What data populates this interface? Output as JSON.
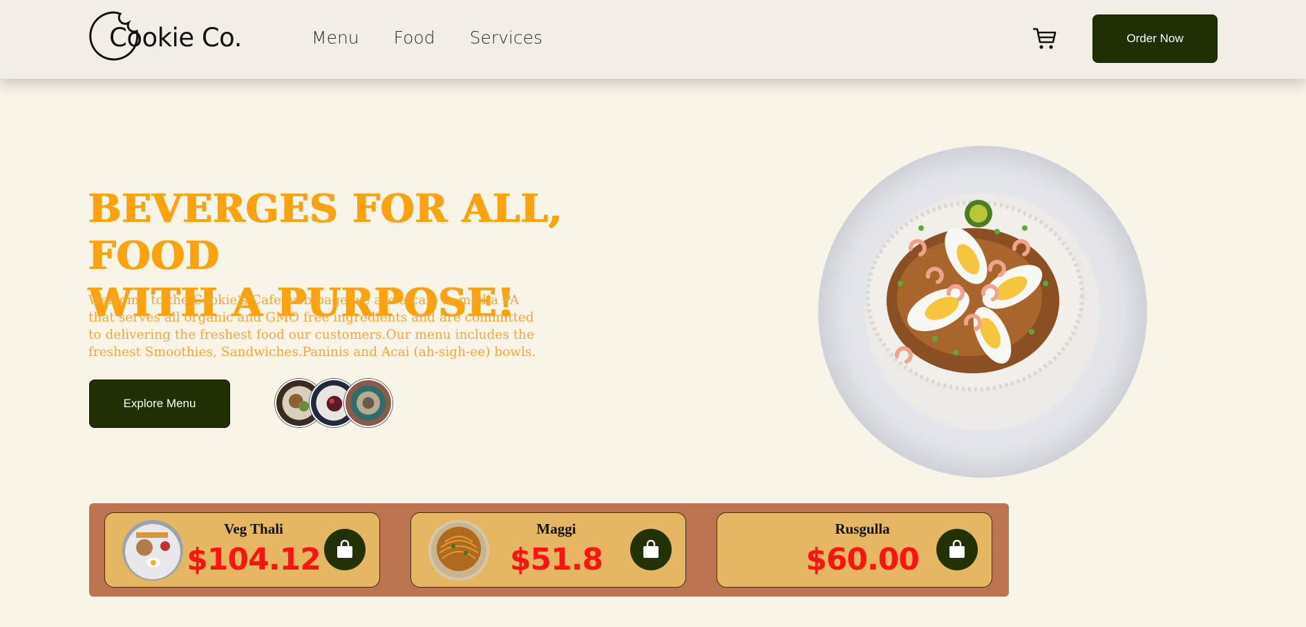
{
  "header": {
    "logo_text": "Cookie Co.",
    "nav": [
      "Menu",
      "Food",
      "Services"
    ],
    "order_button": "Order Now"
  },
  "hero": {
    "headline_line1": "BEVERGES FOR ALL, FOOD",
    "headline_line2": "WITH A PURPOSE!",
    "intro": "Welcome to the Cookie's Cafe web page.we are a cafe in media PA that serves all organic and GMO free ingredients and are committed to delivering the freshest food our customers.Our menu includes the freshest Smoothies, Sandwiches.Paninis and Acai (ah-sigh-ee) bowls.",
    "explore_button": "Explore Menu"
  },
  "products": [
    {
      "name": "Veg Thali",
      "price": "$104.12"
    },
    {
      "name": "Maggi",
      "price": "$51.8"
    },
    {
      "name": "Rusgulla",
      "price": "$60.00"
    }
  ],
  "colors": {
    "background": "#f8f4e8",
    "header": "#f2eee5",
    "button_dark": "#213002",
    "headline": "#fba20c",
    "strip": "#bd7551",
    "card": "#e5b763",
    "price": "#ff1212"
  },
  "icons": {
    "logo": "cookie-bite-icon",
    "cart": "shopping-cart-icon",
    "card_action": "shopping-bag-icon"
  }
}
